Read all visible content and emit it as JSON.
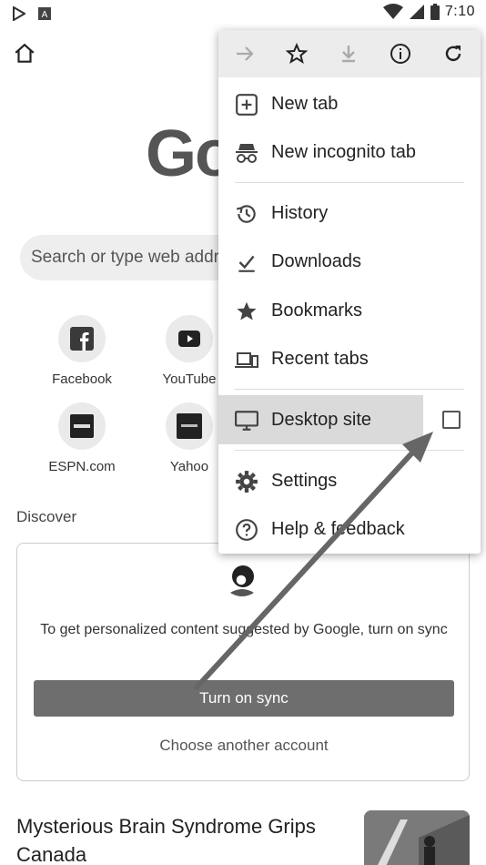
{
  "status_bar": {
    "time": "7:10"
  },
  "google_logo": {
    "text": "Go"
  },
  "search": {
    "placeholder": "Search or type web address"
  },
  "tiles": [
    {
      "label": "Facebook",
      "icon": "facebook-icon"
    },
    {
      "label": "YouTube",
      "icon": "youtube-icon"
    },
    {
      "label": "ESPN.com",
      "icon": "espn-icon"
    },
    {
      "label": "Yahoo",
      "icon": "yahoo-icon"
    }
  ],
  "discover": {
    "heading": "Discover"
  },
  "sync_card": {
    "text": "To get personalized content suggested by Google, turn on sync",
    "button_label": "Turn on sync",
    "other_account": "Choose another account"
  },
  "article": {
    "title": "Mysterious Brain Syndrome Grips Canada"
  },
  "menu": {
    "toolbar": [
      "forward-icon",
      "star-icon",
      "download-icon",
      "info-icon",
      "refresh-icon"
    ],
    "items": [
      {
        "label": "New tab",
        "icon": "new-tab-icon"
      },
      {
        "label": "New incognito tab",
        "icon": "incognito-icon"
      },
      {
        "label": "History",
        "icon": "history-icon"
      },
      {
        "label": "Downloads",
        "icon": "downloads-icon"
      },
      {
        "label": "Bookmarks",
        "icon": "bookmarks-icon"
      },
      {
        "label": "Recent tabs",
        "icon": "recent-tabs-icon"
      },
      {
        "label": "Desktop site",
        "icon": "desktop-icon",
        "checked": false
      },
      {
        "label": "Settings",
        "icon": "settings-icon"
      },
      {
        "label": "Help & feedback",
        "icon": "help-icon"
      }
    ]
  },
  "colors": {
    "arrow": "#666666",
    "menu_highlight": "#dadada",
    "sync_button": "#6e6e6e"
  }
}
